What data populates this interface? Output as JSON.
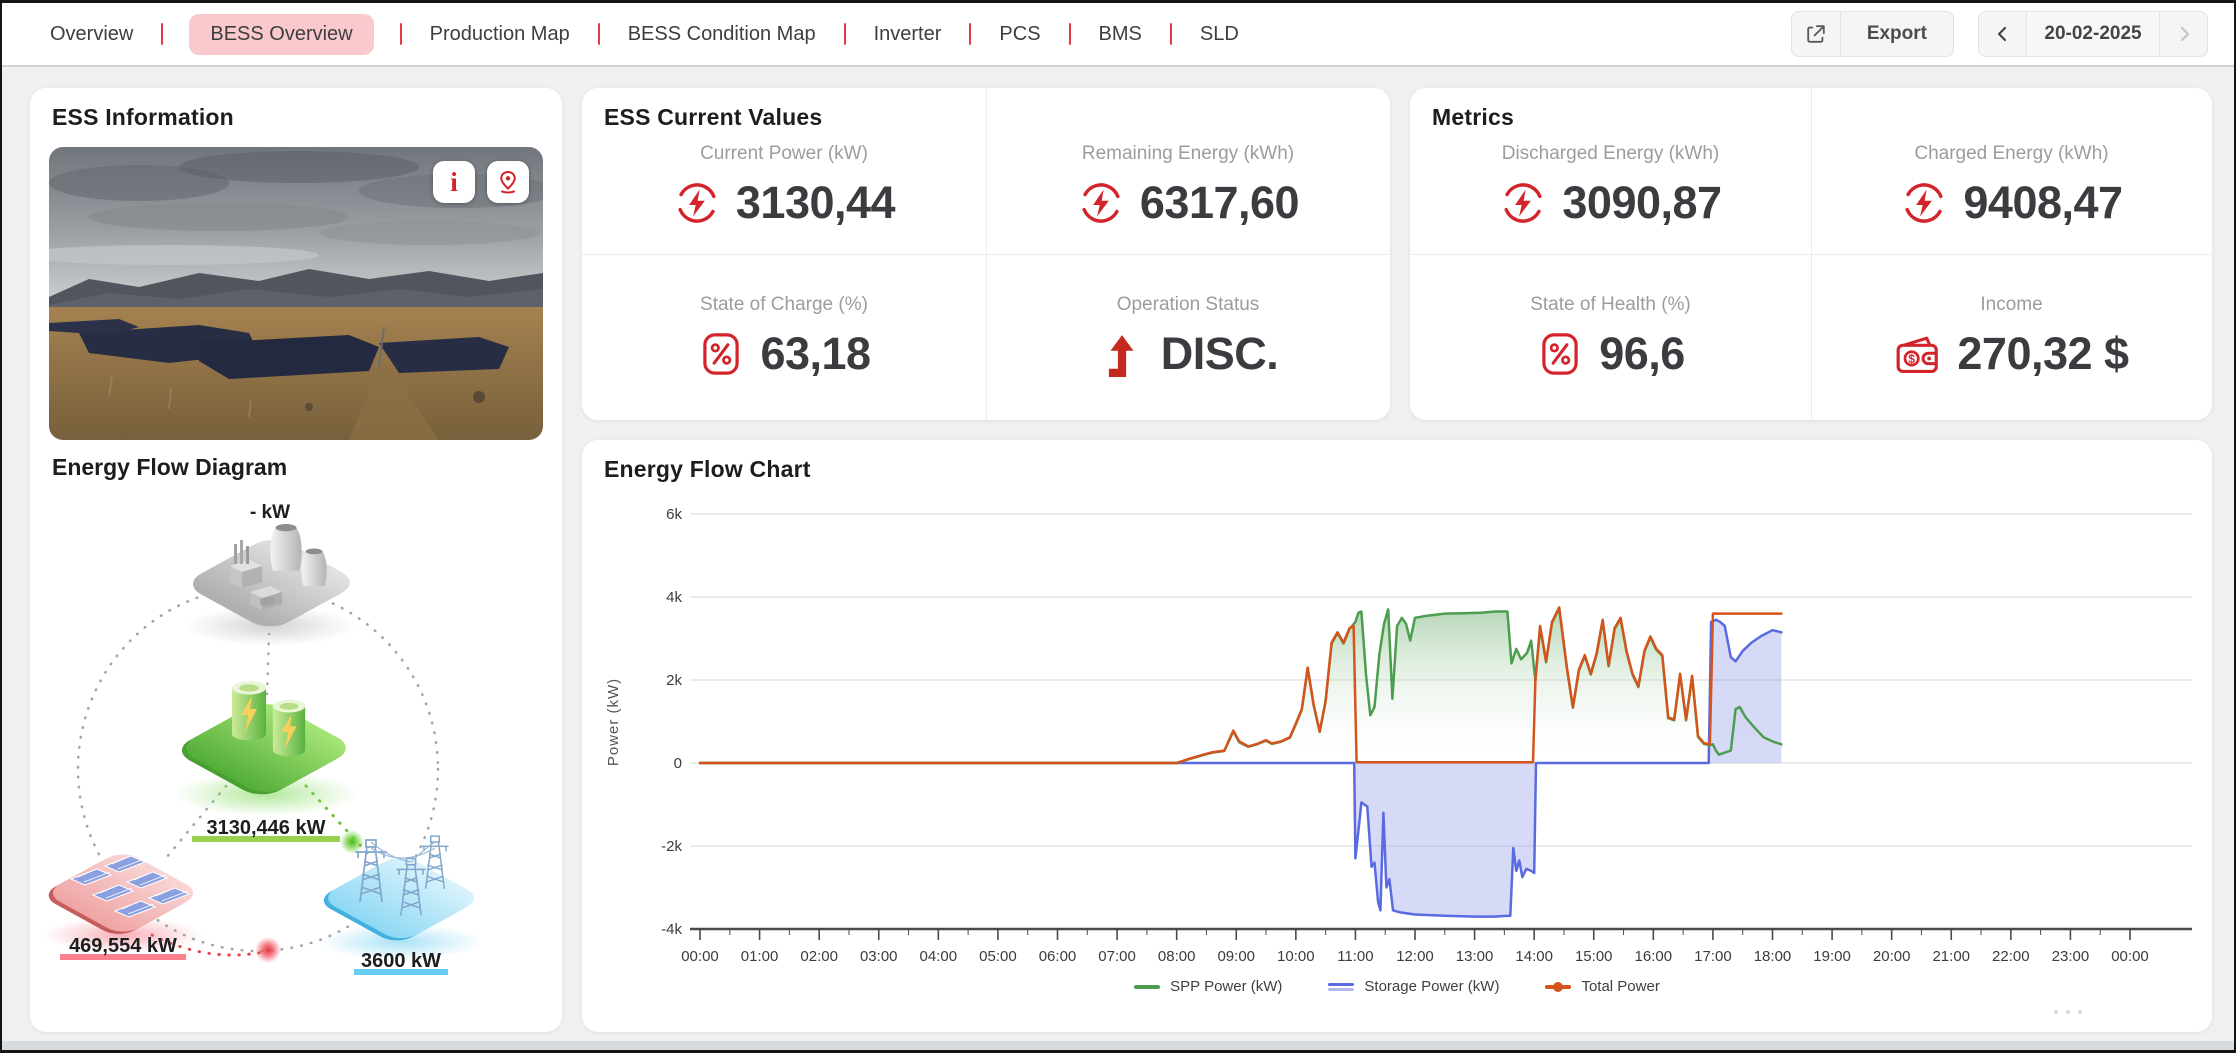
{
  "colors": {
    "accent_red": "#e63946",
    "active_pill": "#f9c9cd",
    "icon_red": "#d3242b",
    "spp_green": "#4c9e4f",
    "storage_blue": "#5a6ae0",
    "total_orange": "#d4541c",
    "diagram_green_underline": "#97d14e",
    "diagram_pink_underline": "#f9808d",
    "diagram_cyan_underline": "#66cdf5"
  },
  "nav": {
    "items": [
      {
        "label": "Overview",
        "active": false
      },
      {
        "label": "BESS Overview",
        "active": true
      },
      {
        "label": "Production Map",
        "active": false
      },
      {
        "label": "BESS Condition Map",
        "active": false
      },
      {
        "label": "Inverter",
        "active": false
      },
      {
        "label": "PCS",
        "active": false
      },
      {
        "label": "BMS",
        "active": false
      },
      {
        "label": "SLD",
        "active": false
      }
    ],
    "export_label": "Export",
    "date": "20-02-2025"
  },
  "ess_information": {
    "title": "ESS Information"
  },
  "energy_flow_diagram": {
    "title": "Energy Flow Diagram",
    "plant_value": "- kW",
    "battery_value": "3130,446 kW",
    "solar_value": "469,554 kW",
    "grid_value": "3600 kW"
  },
  "ess_current_values": {
    "title": "ESS Current Values",
    "cells": [
      {
        "label": "Current Power (kW)",
        "value": "3130,44",
        "icon": "energy"
      },
      {
        "label": "Remaining Energy (kWh)",
        "value": "6317,60",
        "icon": "energy"
      },
      {
        "label": "State of Charge (%)",
        "value": "63,18",
        "icon": "percent"
      },
      {
        "label": "Operation Status",
        "value": "DISC.",
        "icon": "arrow-up"
      }
    ]
  },
  "metrics": {
    "title": "Metrics",
    "cells": [
      {
        "label": "Discharged Energy (kWh)",
        "value": "3090,87",
        "icon": "energy"
      },
      {
        "label": "Charged Energy (kWh)",
        "value": "9408,47",
        "icon": "energy"
      },
      {
        "label": "State of Health (%)",
        "value": "96,6",
        "icon": "percent"
      },
      {
        "label": "Income",
        "value": "270,32 $",
        "icon": "wallet"
      }
    ]
  },
  "chart_data": {
    "type": "line",
    "title": "Energy Flow Chart",
    "xlabel": "",
    "ylabel": "Power (kW)",
    "ylim": [
      -4000,
      6000
    ],
    "grid": true,
    "legend_position": "bottom",
    "yticks": [
      {
        "v": 6000,
        "label": "6k"
      },
      {
        "v": 4000,
        "label": "4k"
      },
      {
        "v": 2000,
        "label": "2k"
      },
      {
        "v": 0,
        "label": "0"
      },
      {
        "v": -2000,
        "label": "-2k"
      },
      {
        "v": -4000,
        "label": "-4k"
      }
    ],
    "xtick_labels": [
      "00:00",
      "01:00",
      "02:00",
      "03:00",
      "04:00",
      "05:00",
      "06:00",
      "07:00",
      "08:00",
      "09:00",
      "10:00",
      "11:00",
      "12:00",
      "13:00",
      "14:00",
      "15:00",
      "16:00",
      "17:00",
      "18:00",
      "19:00",
      "20:00",
      "21:00",
      "22:00",
      "23:00",
      "00:00"
    ],
    "legend": [
      {
        "name": "SPP Power (kW)",
        "color": "#4c9e4f",
        "swatch": "line"
      },
      {
        "name": "Storage Power (kW)",
        "color": "#5a6ae0",
        "swatch": "double"
      },
      {
        "name": "Total Power",
        "color": "#d4541c",
        "swatch": "dot"
      }
    ],
    "series": [
      {
        "name": "SPP Power (kW)",
        "color": "#4c9e4f",
        "fill": "green",
        "points": [
          [
            0,
            0
          ],
          [
            8,
            0
          ],
          [
            8.2,
            90
          ],
          [
            8.4,
            170
          ],
          [
            8.6,
            250
          ],
          [
            8.8,
            290
          ],
          [
            8.95,
            760
          ],
          [
            9.05,
            500
          ],
          [
            9.2,
            390
          ],
          [
            9.35,
            450
          ],
          [
            9.5,
            540
          ],
          [
            9.6,
            460
          ],
          [
            9.75,
            510
          ],
          [
            9.9,
            610
          ],
          [
            10.0,
            930
          ],
          [
            10.1,
            1280
          ],
          [
            10.2,
            2280
          ],
          [
            10.3,
            1380
          ],
          [
            10.4,
            750
          ],
          [
            10.5,
            1480
          ],
          [
            10.6,
            2880
          ],
          [
            10.7,
            3130
          ],
          [
            10.8,
            2880
          ],
          [
            10.9,
            3230
          ],
          [
            11.0,
            3400
          ],
          [
            11.05,
            3620
          ],
          [
            11.1,
            3650
          ],
          [
            11.18,
            2100
          ],
          [
            11.25,
            1150
          ],
          [
            11.32,
            1350
          ],
          [
            11.4,
            2600
          ],
          [
            11.48,
            3350
          ],
          [
            11.55,
            3700
          ],
          [
            11.62,
            1550
          ],
          [
            11.7,
            3300
          ],
          [
            11.78,
            3500
          ],
          [
            11.85,
            3350
          ],
          [
            11.92,
            2950
          ],
          [
            12.0,
            3500
          ],
          [
            12.2,
            3550
          ],
          [
            12.5,
            3600
          ],
          [
            12.8,
            3610
          ],
          [
            13.1,
            3620
          ],
          [
            13.35,
            3650
          ],
          [
            13.55,
            3650
          ],
          [
            13.62,
            2400
          ],
          [
            13.7,
            2750
          ],
          [
            13.78,
            2500
          ],
          [
            13.88,
            2650
          ],
          [
            13.95,
            2950
          ],
          [
            14.02,
            1980
          ],
          [
            14.1,
            3280
          ],
          [
            14.2,
            2430
          ],
          [
            14.3,
            3380
          ],
          [
            14.42,
            3730
          ],
          [
            14.55,
            2280
          ],
          [
            14.65,
            1330
          ],
          [
            14.75,
            2230
          ],
          [
            14.85,
            2580
          ],
          [
            14.95,
            2130
          ],
          [
            15.05,
            2630
          ],
          [
            15.15,
            3430
          ],
          [
            15.25,
            2330
          ],
          [
            15.35,
            3230
          ],
          [
            15.45,
            3480
          ],
          [
            15.55,
            2680
          ],
          [
            15.65,
            2130
          ],
          [
            15.75,
            1830
          ],
          [
            15.85,
            2680
          ],
          [
            15.95,
            3030
          ],
          [
            16.05,
            2730
          ],
          [
            16.15,
            2580
          ],
          [
            16.25,
            1080
          ],
          [
            16.35,
            1030
          ],
          [
            16.45,
            2130
          ],
          [
            16.55,
            1030
          ],
          [
            16.65,
            2080
          ],
          [
            16.75,
            630
          ],
          [
            16.85,
            460
          ],
          [
            16.95,
            430
          ],
          [
            17.0,
            450
          ],
          [
            17.05,
            300
          ],
          [
            17.1,
            200
          ],
          [
            17.2,
            250
          ],
          [
            17.3,
            300
          ],
          [
            17.38,
            1300
          ],
          [
            17.45,
            1350
          ],
          [
            17.55,
            1100
          ],
          [
            17.7,
            850
          ],
          [
            17.85,
            620
          ],
          [
            18.0,
            520
          ],
          [
            18.15,
            450
          ]
        ]
      },
      {
        "name": "Storage Power (kW)",
        "color": "#5a6ae0",
        "fill": "blue",
        "points": [
          [
            0,
            0
          ],
          [
            10.98,
            0
          ],
          [
            11.0,
            -2300
          ],
          [
            11.06,
            -1500
          ],
          [
            11.1,
            -950
          ],
          [
            11.2,
            -1050
          ],
          [
            11.27,
            -2500
          ],
          [
            11.32,
            -2400
          ],
          [
            11.38,
            -3350
          ],
          [
            11.42,
            -3550
          ],
          [
            11.47,
            -1200
          ],
          [
            11.52,
            -3000
          ],
          [
            11.57,
            -2800
          ],
          [
            11.63,
            -3550
          ],
          [
            11.75,
            -3600
          ],
          [
            12.0,
            -3650
          ],
          [
            12.5,
            -3680
          ],
          [
            13.0,
            -3700
          ],
          [
            13.35,
            -3700
          ],
          [
            13.45,
            -3690
          ],
          [
            13.6,
            -3680
          ],
          [
            13.65,
            -2050
          ],
          [
            13.7,
            -2600
          ],
          [
            13.75,
            -2350
          ],
          [
            13.8,
            -2750
          ],
          [
            13.87,
            -2550
          ],
          [
            13.95,
            -2600
          ],
          [
            14.0,
            -2650
          ],
          [
            14.03,
            0
          ],
          [
            16.93,
            0
          ],
          [
            16.97,
            3400
          ],
          [
            17.05,
            3450
          ],
          [
            17.12,
            3400
          ],
          [
            17.2,
            3300
          ],
          [
            17.3,
            2550
          ],
          [
            17.38,
            2450
          ],
          [
            17.5,
            2700
          ],
          [
            17.65,
            2900
          ],
          [
            17.8,
            3050
          ],
          [
            18.0,
            3200
          ],
          [
            18.15,
            3150
          ]
        ]
      },
      {
        "name": "Total Power",
        "color": "#d4541c",
        "fill": "none",
        "points": [
          [
            0,
            0
          ],
          [
            8,
            0
          ],
          [
            8.2,
            100
          ],
          [
            8.4,
            180
          ],
          [
            8.6,
            260
          ],
          [
            8.8,
            300
          ],
          [
            8.95,
            780
          ],
          [
            9.05,
            520
          ],
          [
            9.2,
            400
          ],
          [
            9.35,
            460
          ],
          [
            9.5,
            550
          ],
          [
            9.6,
            470
          ],
          [
            9.75,
            520
          ],
          [
            9.9,
            620
          ],
          [
            10.0,
            950
          ],
          [
            10.1,
            1300
          ],
          [
            10.2,
            2300
          ],
          [
            10.3,
            1400
          ],
          [
            10.4,
            760
          ],
          [
            10.5,
            1500
          ],
          [
            10.6,
            2900
          ],
          [
            10.7,
            3150
          ],
          [
            10.8,
            2900
          ],
          [
            10.9,
            3250
          ],
          [
            10.97,
            3300
          ],
          [
            11.02,
            20
          ],
          [
            13.98,
            20
          ],
          [
            14.02,
            2000
          ],
          [
            14.1,
            3300
          ],
          [
            14.2,
            2450
          ],
          [
            14.3,
            3400
          ],
          [
            14.42,
            3750
          ],
          [
            14.55,
            2300
          ],
          [
            14.65,
            1350
          ],
          [
            14.75,
            2250
          ],
          [
            14.85,
            2600
          ],
          [
            14.95,
            2150
          ],
          [
            15.05,
            2650
          ],
          [
            15.15,
            3450
          ],
          [
            15.25,
            2350
          ],
          [
            15.35,
            3250
          ],
          [
            15.45,
            3500
          ],
          [
            15.55,
            2700
          ],
          [
            15.65,
            2150
          ],
          [
            15.75,
            1850
          ],
          [
            15.85,
            2700
          ],
          [
            15.95,
            3050
          ],
          [
            16.05,
            2750
          ],
          [
            16.15,
            2600
          ],
          [
            16.25,
            1100
          ],
          [
            16.35,
            1050
          ],
          [
            16.45,
            2150
          ],
          [
            16.55,
            1050
          ],
          [
            16.65,
            2100
          ],
          [
            16.75,
            650
          ],
          [
            16.85,
            480
          ],
          [
            16.95,
            450
          ],
          [
            17.0,
            3600
          ],
          [
            18.15,
            3600
          ]
        ]
      }
    ]
  }
}
